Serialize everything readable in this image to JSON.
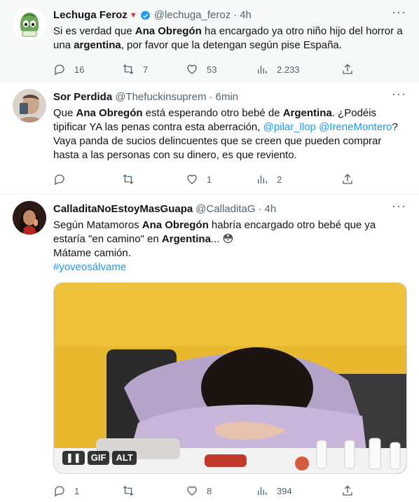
{
  "tweets": [
    {
      "name": "Lechuga Feroz",
      "handle": "@lechuga_feroz",
      "time": "4h",
      "text_parts": [
        "Si es verdad que ",
        "Ana Obregón",
        " ha encargado ya otro niño hijo del horror a una ",
        "argentina",
        ", por favor que la detengan según pise España."
      ],
      "replies": "16",
      "retweets": "7",
      "likes": "53",
      "views": "2.233"
    },
    {
      "name": "Sor Perdida",
      "handle": "@Thefuckinsuprem",
      "time": "6min",
      "text_parts": [
        "Que ",
        "Ana Obregón",
        " está esperando otro bebé de ",
        "Argentina",
        ". ¿Podéis tipificar YA las penas contra esta aberración, ",
        "@pilar_llop",
        " ",
        "@IreneMontero",
        "? Vaya panda de sucios delincuentes que se creen que pueden comprar hasta a las personas con su dinero, es que reviento."
      ],
      "replies": "",
      "retweets": "",
      "likes": "1",
      "views": "2"
    },
    {
      "name": "CalladitaNoEstoyMasGuapa",
      "handle": "@CalladitaG",
      "time": "4h",
      "text_parts": [
        "Según Matamoros ",
        "Ana Obregón",
        " habría encargado otro bebé que ya estaría \"en camino\" en ",
        "Argentina",
        "... 😳"
      ],
      "line2": "Mátame camión.",
      "hashtag": "#yoveosálvame",
      "media_pills": [
        "❚❚",
        "GIF",
        "ALT"
      ],
      "replies": "1",
      "retweets": "",
      "likes": "8",
      "views": "394"
    }
  ],
  "dot": "·",
  "more": "···",
  "colors": {
    "link": "#1d9bf0",
    "muted": "#536471",
    "verified": "#1d9bf0"
  }
}
